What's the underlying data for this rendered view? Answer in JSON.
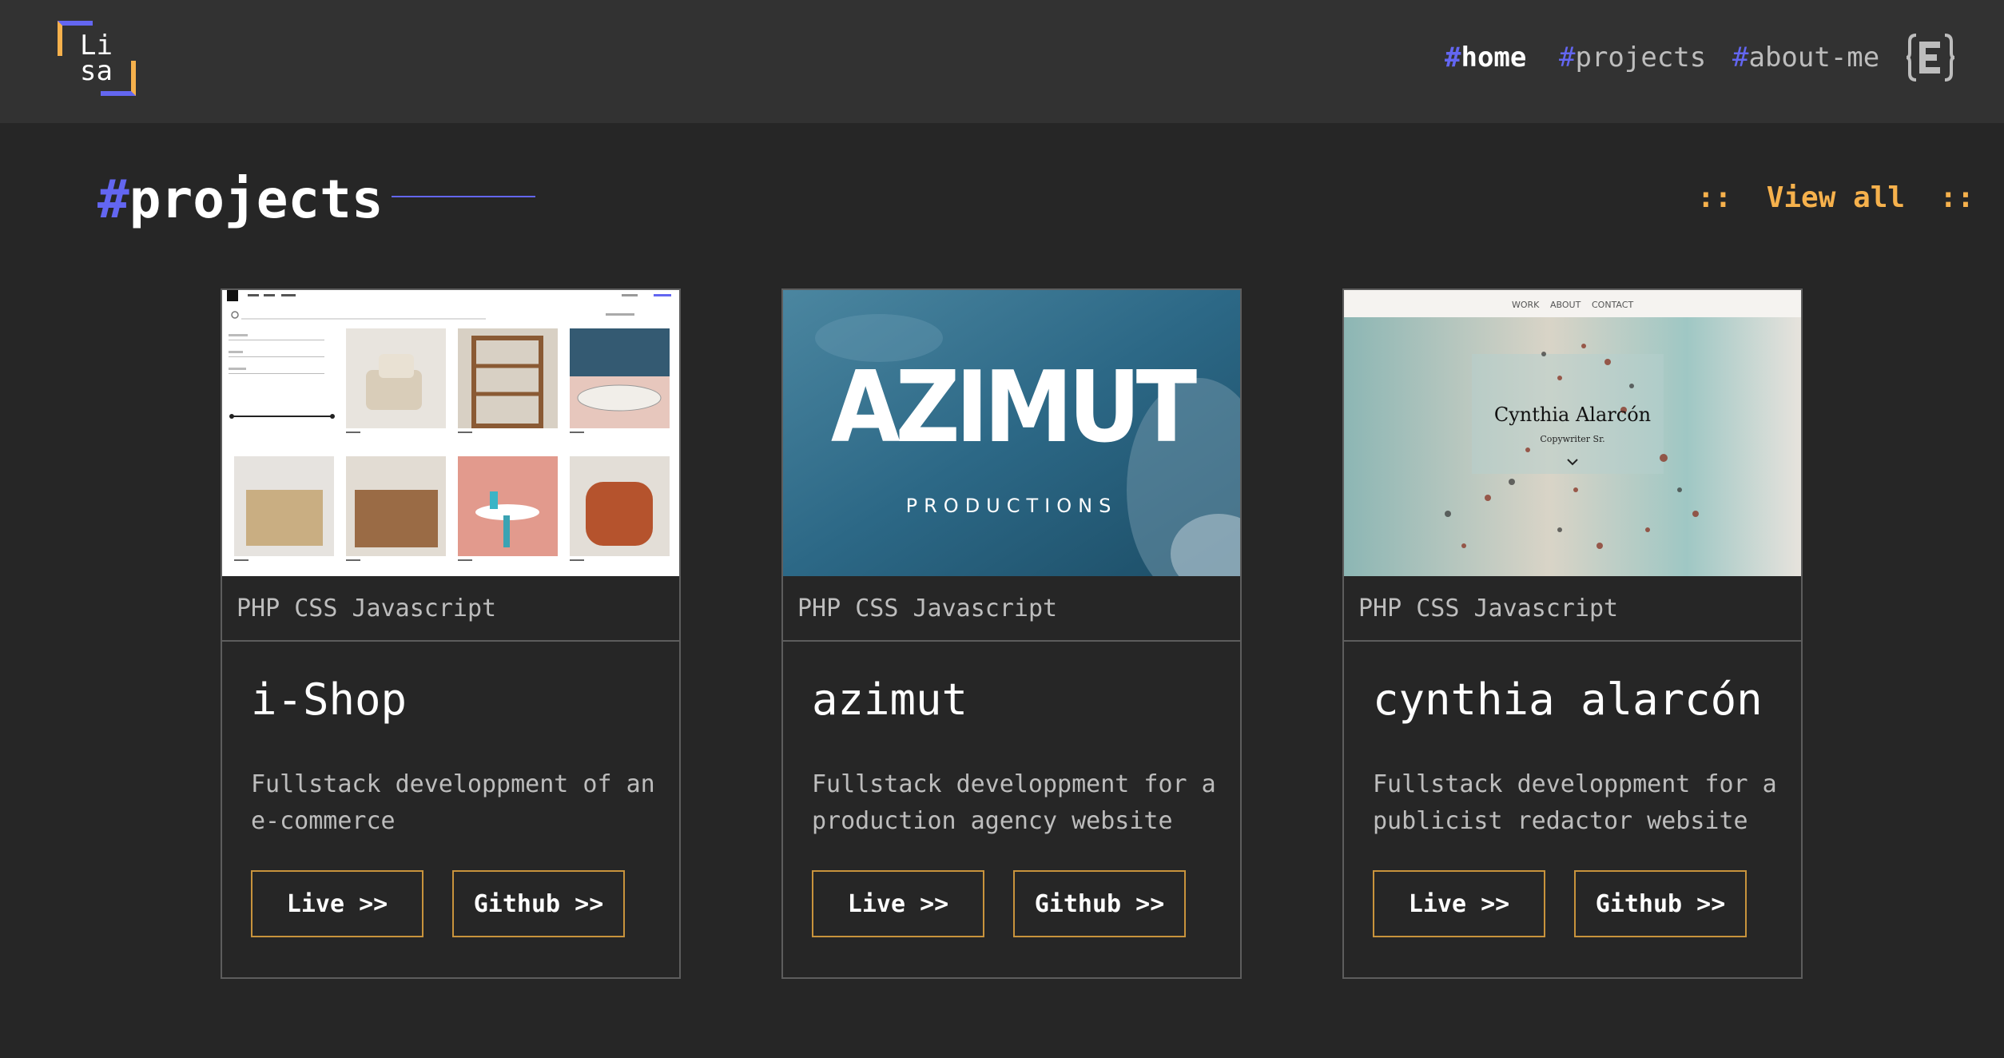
{
  "logo": {
    "line1": "Li",
    "line2": "sa"
  },
  "nav": {
    "items": [
      {
        "hash": "#",
        "label": "home"
      },
      {
        "hash": "#",
        "label": "projects"
      },
      {
        "hash": "#",
        "label": "about-me"
      }
    ],
    "theme_icon": "bracket-e-icon"
  },
  "section": {
    "hash": "#",
    "title": "projects",
    "view_all": "::  View all  ::"
  },
  "projects": [
    {
      "tags": "PHP CSS Javascript",
      "title": "i-Shop",
      "description": "Fullstack developpment of an e-commerce",
      "live": "Live >>",
      "github": "Github >>"
    },
    {
      "tags": "PHP CSS Javascript",
      "title": "azimut",
      "description": "Fullstack developpment for a production agency website",
      "live": "Live >>",
      "github": "Github >>",
      "thumb_logo": "AZIMUT",
      "thumb_sub": "PRODUCTIONS"
    },
    {
      "tags": "PHP CSS Javascript",
      "title": "cynthia alarcón",
      "description": "Fullstack developpment for a publicist redactor website",
      "live": "Live >>",
      "github": "Github >>",
      "thumb_nav": [
        "WORK",
        "ABOUT",
        "CONTACT"
      ],
      "thumb_name": "Cynthia Alarcón",
      "thumb_sub": "Copywriter Sr."
    }
  ],
  "colors": {
    "accent": "#6366f1",
    "secondary": "#f6b14c",
    "bg": "#262626",
    "header": "#323232"
  }
}
